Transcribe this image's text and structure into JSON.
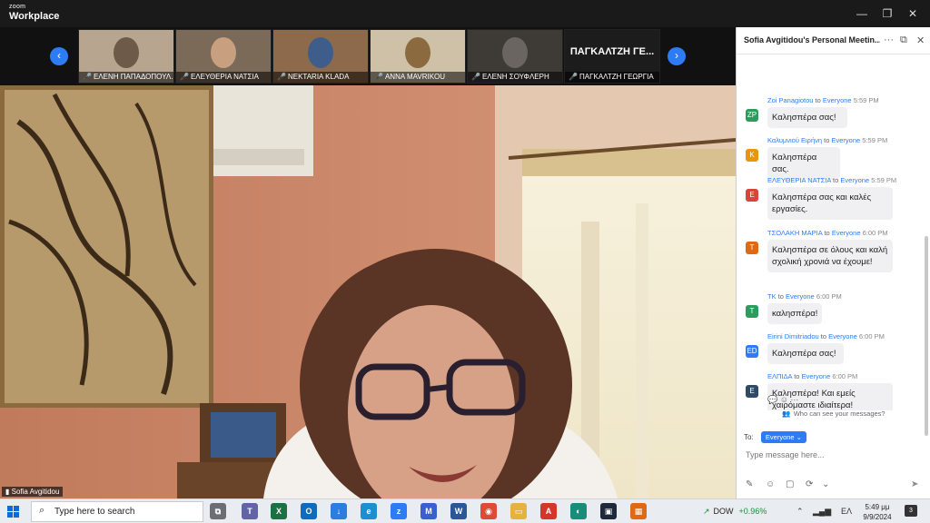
{
  "app": {
    "brand_small": "zoom",
    "brand_big": "Workplace"
  },
  "window_controls": {
    "minimize": "—",
    "restore": "❐",
    "close": "✕"
  },
  "gallery": {
    "prev": "‹",
    "next": "›",
    "participants": [
      {
        "name": "ΕΛΕΝΗ ΠΑΠΑΔΟΠΟΥΛ...",
        "bg": "#b7a58f",
        "accent": "#6d5a48"
      },
      {
        "name": "ΕΛΕΥΘΕΡΙΑ ΝΑΤΣΙΑ",
        "bg": "#7c6a58",
        "accent": "#c89f7f"
      },
      {
        "name": "NEKTARIA KLADA",
        "bg": "#8d6a4c",
        "accent": "#3f5d8a"
      },
      {
        "name": "ANNA MAVRIKOU",
        "bg": "#cfc0a8",
        "accent": "#8a6a3e"
      },
      {
        "name": "ΕΛΕΝΗ ΣΟΥΦΛΕΡΗ",
        "bg": "#3e3a36",
        "accent": "#6a6560"
      },
      {
        "name": "ΠΑΓΚΑΛΤΖΗ ΓΕΩΡΓΙΑ",
        "bg": "#1c1c1c",
        "accent": "#1c1c1c",
        "big": "ΠΑΓΚΑΛΤΖΗ ΓΕ..."
      }
    ]
  },
  "speaker": {
    "name": "Sofia Avgitidou"
  },
  "chat": {
    "title": "Sofia Avgitidou's Personal Meetin...",
    "more": "···",
    "popout": "⧉",
    "close": "✕",
    "to_word": "to",
    "messages": [
      {
        "initials": "ZP",
        "color": "#2a9d5c",
        "sender": "Zoi Panagiotou",
        "to": "Everyone",
        "time": "5:59 PM",
        "text": "Καλησπέρα σας!"
      },
      {
        "initials": "K",
        "color": "#e8950f",
        "sender": "Καλυμνιού Ειρήνη",
        "to": "Everyone",
        "time": "5:59 PM",
        "text": "Καλησπέρα σας."
      },
      {
        "initials": "E",
        "color": "#d6443a",
        "sender": "ΕΛΕΥΘΕΡΙΑ ΝΑΤΣΙΑ",
        "to": "Everyone",
        "time": "5:59 PM",
        "text": "Καλησπέρα σας και καλές εργασίες."
      },
      {
        "initials": "T",
        "color": "#e06a14",
        "sender": "ΤΣΟΛΑΚΗ ΜΑΡΙΑ",
        "to": "Everyone",
        "time": "6:00 PM",
        "text": "Καλησπέρα σε όλους και καλή σχολική χρονιά να έχουμε!"
      },
      {
        "initials": "T",
        "color": "#2a9d5c",
        "sender": "TK",
        "to": "Everyone",
        "time": "6:00 PM",
        "text": "καλησπέρα!"
      },
      {
        "initials": "ED",
        "color": "#2d7cf6",
        "sender": "Eirini Dimitriadou",
        "to": "Everyone",
        "time": "6:00 PM",
        "text": "Καλησπέρα σας!"
      },
      {
        "initials": "E",
        "color": "#2f4a66",
        "sender": "ΕΛΠΙΔΑ",
        "to": "Everyone",
        "time": "6:00 PM",
        "text": "Καλησπέρα! Και εμείς χαιρόμαστε ιδιαίτερα!"
      }
    ],
    "reactions": "💬 ☺ ···",
    "who_can_see": "Who can see your messages?",
    "to_label": "To:",
    "to_value": "Everyone ⌄",
    "input_placeholder": "Type message here...",
    "send": "➤"
  },
  "taskbar": {
    "search_placeholder": "Type here to search",
    "apps": [
      {
        "name": "task-view-icon",
        "label": "⧉",
        "color": "#6b6f75"
      },
      {
        "name": "teams-icon",
        "label": "T",
        "color": "#6264a7"
      },
      {
        "name": "excel-icon",
        "label": "X",
        "color": "#1d7044"
      },
      {
        "name": "outlook-icon",
        "label": "O",
        "color": "#0f6cbd"
      },
      {
        "name": "download-icon",
        "label": "↓",
        "color": "#2b7de0"
      },
      {
        "name": "edge-icon",
        "label": "e",
        "color": "#1b8fd0"
      },
      {
        "name": "zoom-icon",
        "label": "z",
        "color": "#2d7cf6"
      },
      {
        "name": "app-icon",
        "label": "M",
        "color": "#3b5fcf"
      },
      {
        "name": "word-icon",
        "label": "W",
        "color": "#2b5797"
      },
      {
        "name": "chrome-icon",
        "label": "◉",
        "color": "#de4a3a"
      },
      {
        "name": "explorer-icon",
        "label": "▭",
        "color": "#e3b33c"
      },
      {
        "name": "acrobat-icon",
        "label": "A",
        "color": "#d4372a"
      },
      {
        "name": "app2-icon",
        "label": "◐",
        "color": "#1a8c7a"
      },
      {
        "name": "app3-icon",
        "label": "▣",
        "color": "#1e2a3a"
      },
      {
        "name": "app4-icon",
        "label": "▦",
        "color": "#e06a14"
      }
    ],
    "ticker_name": "DOW",
    "ticker_change": "+0.96%",
    "ticker_arrow": "↗",
    "tray_up": "⌃",
    "tray_wifi": "📶",
    "tray_lang": "ΕΛ",
    "time": "5:49 μμ",
    "date": "9/9/2024",
    "notif": "3"
  }
}
